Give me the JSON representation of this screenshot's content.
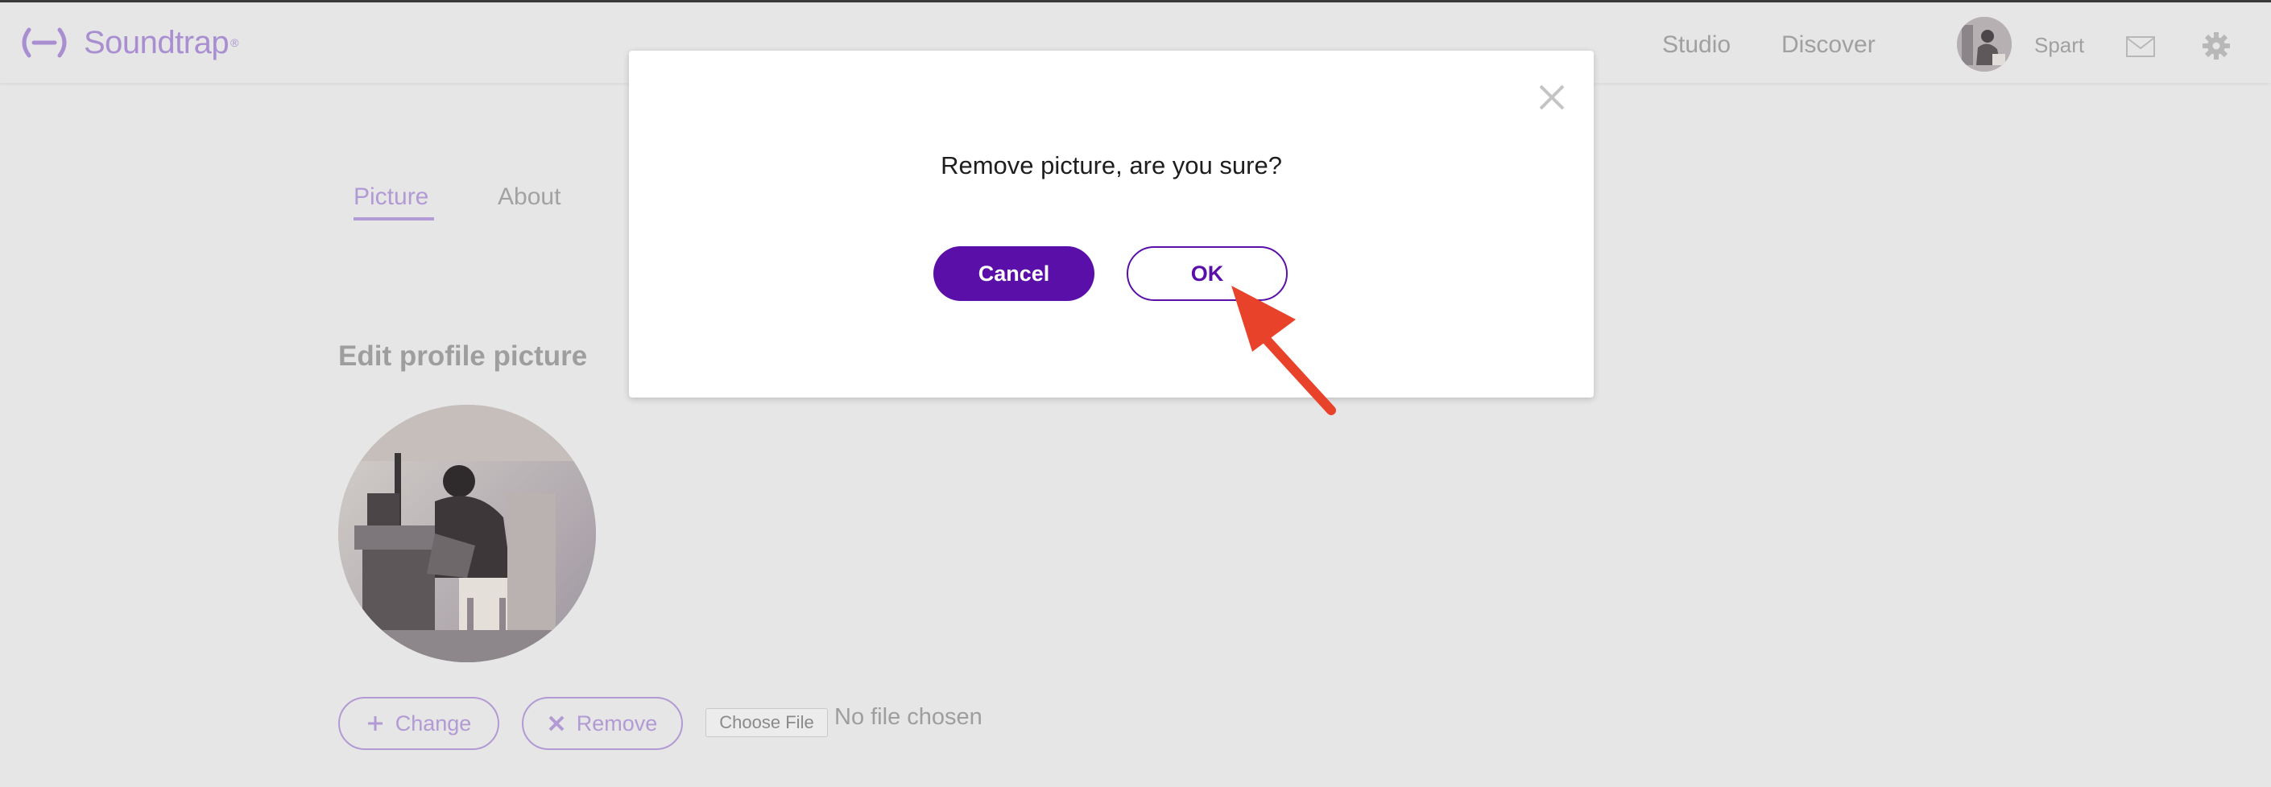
{
  "header": {
    "brand": "Soundtrap",
    "brand_mark": "®",
    "nav": {
      "studio": "Studio",
      "discover": "Discover"
    },
    "username": "Spart"
  },
  "tabs": [
    {
      "label": "Picture",
      "active": true
    },
    {
      "label": "About",
      "active": false
    }
  ],
  "profile": {
    "section_title": "Edit profile picture",
    "change_label": "Change",
    "remove_label": "Remove",
    "choose_file_label": "Choose File",
    "file_status": "No file chosen"
  },
  "dialog": {
    "message": "Remove picture, are you sure?",
    "cancel_label": "Cancel",
    "ok_label": "OK"
  },
  "icons": [
    "logo-icon",
    "mail-icon",
    "gear-icon",
    "close-icon",
    "plus-icon",
    "x-icon",
    "arrow-pointer-icon"
  ],
  "colors": {
    "brand_purple": "#5a0fa8",
    "muted_purple": "#b29ad4",
    "overlay_gray": "#e6e6e6",
    "annotation_red": "#e8432a"
  }
}
